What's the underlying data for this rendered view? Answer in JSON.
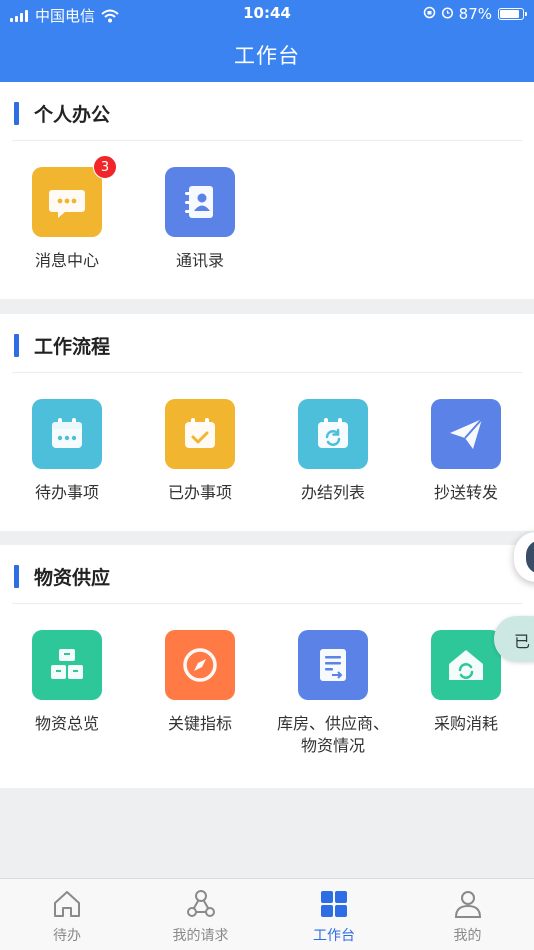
{
  "status_bar": {
    "carrier": "中国电信",
    "time": "10:44",
    "battery": "87%",
    "battery_level": 0.87,
    "icons": [
      "signal-icon",
      "wifi-icon",
      "orientation-lock-icon",
      "alarm-icon",
      "battery-icon"
    ]
  },
  "header": {
    "title": "工作台"
  },
  "sections": [
    {
      "title": "个人办公",
      "items": [
        {
          "label": "消息中心",
          "icon": "message-icon",
          "color": "#f2b530",
          "badge": "3"
        },
        {
          "label": "通讯录",
          "icon": "contacts-icon",
          "color": "#5b82e6"
        }
      ]
    },
    {
      "title": "工作流程",
      "items": [
        {
          "label": "待办事项",
          "icon": "calendar-pending-icon",
          "color": "#4dbfdb"
        },
        {
          "label": "已办事项",
          "icon": "calendar-done-icon",
          "color": "#f2b530"
        },
        {
          "label": "办结列表",
          "icon": "calendar-refresh-icon",
          "color": "#4dbfdb"
        },
        {
          "label": "抄送转发",
          "icon": "send-icon",
          "color": "#5b82e6"
        }
      ]
    },
    {
      "title": "物资供应",
      "items": [
        {
          "label": "物资总览",
          "icon": "boxes-icon",
          "color": "#2ec79a"
        },
        {
          "label": "关键指标",
          "icon": "compass-icon",
          "color": "#ff7a45"
        },
        {
          "label": "库房、供应商、物资情况",
          "icon": "document-icon",
          "color": "#5b82e6"
        },
        {
          "label": "采购消耗",
          "icon": "warehouse-refresh-icon",
          "color": "#2ec79a"
        }
      ]
    }
  ],
  "floating_tag": {
    "text": "已"
  },
  "tabbar": {
    "items": [
      {
        "label": "待办",
        "icon": "home-icon",
        "active": false
      },
      {
        "label": "我的请求",
        "icon": "network-icon",
        "active": false
      },
      {
        "label": "工作台",
        "icon": "grid-icon",
        "active": true
      },
      {
        "label": "我的",
        "icon": "user-icon",
        "active": false
      }
    ],
    "active_color": "#2e6de3",
    "inactive_color": "#8a8a8a"
  }
}
